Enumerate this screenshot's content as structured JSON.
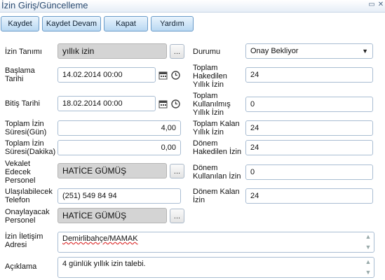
{
  "window": {
    "title": "İzin Giriş/Güncelleme",
    "restore_icon": "window-restore-icon",
    "close_icon": "close-icon"
  },
  "toolbar": {
    "save": "Kaydet",
    "save_continue": "Kaydet Devam",
    "close": "Kapat",
    "help": "Yardım"
  },
  "form": {
    "leave_type": {
      "label": "İzin Tanımı",
      "value": "yıllık izin"
    },
    "start_date": {
      "label1": "Başlama",
      "label2": "Tarihi",
      "value": "14.02.2014 00:00"
    },
    "end_date": {
      "label": "Bitiş Tarihi",
      "value": "18.02.2014 00:00"
    },
    "total_days": {
      "label1": "Toplam İzin",
      "label2": "Süresi(Gün)",
      "value": "4,00"
    },
    "total_minutes": {
      "label1": "Toplam İzin",
      "label2": "Süresi(Dakika)",
      "value": "0,00"
    },
    "proxy": {
      "label1": "Vekalet",
      "label2": "Edecek",
      "label3": "Personel",
      "value": "HATİCE GÜMÜŞ"
    },
    "phone": {
      "label1": "Ulaşılabilecek",
      "label2": "Telefon",
      "value": "(251) 549 84 94"
    },
    "approver": {
      "label1": "Onaylayacak",
      "label2": "Personel",
      "value": "HATİCE GÜMÜŞ"
    },
    "contact_address": {
      "label1": "İzin İletişim",
      "label2": "Adresi",
      "value": "Demirlibahçe/MAMAK"
    },
    "description": {
      "label": "Açıklama",
      "value": "4 günlük yıllık izin talebi."
    },
    "status": {
      "label": "Durumu",
      "value": "Onay Bekliyor"
    },
    "earned_total": {
      "label1": "Toplam",
      "label2": "Hakedilen",
      "label3": "Yıllık İzin",
      "value": "24"
    },
    "used_total": {
      "label1": "Toplam",
      "label2": "Kullanılmış",
      "label3": "Yıllık İzin",
      "value": "0"
    },
    "remaining_total": {
      "label1": "Toplam Kalan",
      "label2": "Yıllık İzin",
      "value": "24"
    },
    "period_earned": {
      "label1": "Dönem",
      "label2": "Hakedilen İzin",
      "value": "24"
    },
    "period_used": {
      "label1": "Dönem",
      "label2": "Kullanılan İzin",
      "value": "0"
    },
    "period_remaining": {
      "label1": "Dönem Kalan",
      "label2": "İzin",
      "value": "24"
    }
  },
  "icons": {
    "lookup": "ellipsis-button",
    "calendar": "calendar-icon",
    "clock": "clock-icon",
    "dropdown": "chevron-down-icon"
  },
  "lookup_label": "..."
}
